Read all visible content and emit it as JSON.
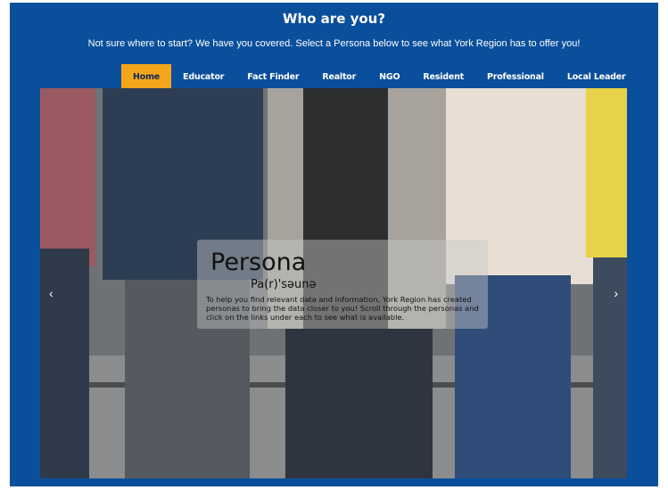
{
  "header": {
    "title": "Who are you?",
    "subtitle": "Not sure where to start? We have you covered. Select a Persona below to see what York Region has to offer you!"
  },
  "nav": {
    "tabs": [
      {
        "label": "Home",
        "active": true
      },
      {
        "label": "Educator",
        "active": false
      },
      {
        "label": "Fact Finder",
        "active": false
      },
      {
        "label": "Realtor",
        "active": false
      },
      {
        "label": "NGO",
        "active": false
      },
      {
        "label": "Resident",
        "active": false
      },
      {
        "label": "Professional",
        "active": false
      },
      {
        "label": "Local Leader",
        "active": false
      }
    ]
  },
  "carousel": {
    "caption_title": "Persona",
    "caption_phonetic": "Pa(r)'səunə",
    "caption_text": "To help you find relevant data and information, York Region has created personas to bring the data closer to you! Scroll through the personas and click on the links under each to see what is available.",
    "prev_icon": "‹",
    "next_icon": "›"
  },
  "colors": {
    "background": "#0a4f9c",
    "active_tab": "#f5a51b"
  }
}
